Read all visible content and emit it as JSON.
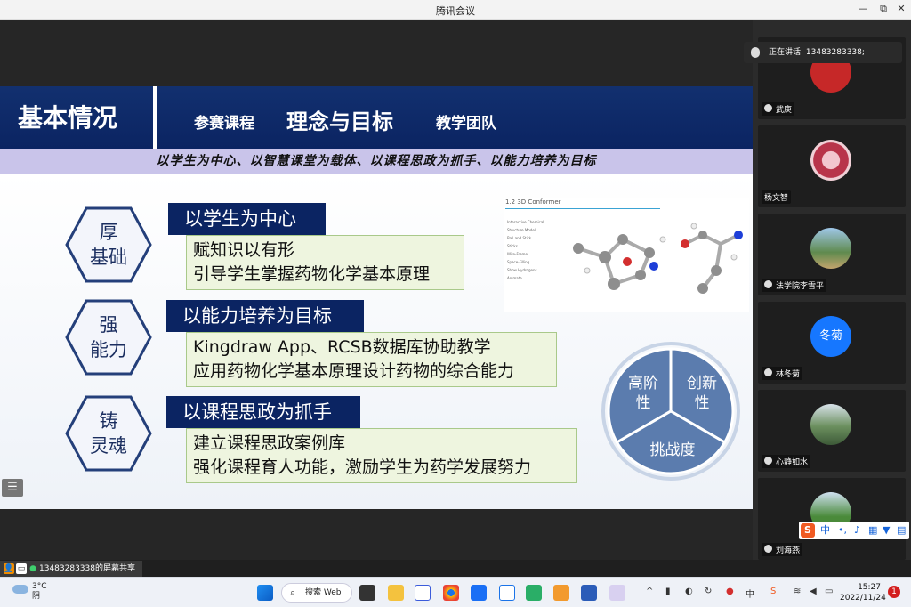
{
  "window": {
    "title": "腾讯会议",
    "min": "—",
    "restore": "⧉",
    "close": "✕"
  },
  "slide": {
    "header_title": "基本情况",
    "tabs": [
      "参赛课程",
      "理念与目标",
      "教学团队"
    ],
    "motto": "以学生为中心、以智慧课堂为载体、以课程思政为抓手、以能力培养为目标",
    "hexes": [
      "厚\n基础",
      "强\n能力",
      "铸\n灵魂"
    ],
    "goals": [
      {
        "title": "以学生为中心",
        "lines": [
          "赋知识以有形",
          "引导学生掌握药物化学基本原理"
        ]
      },
      {
        "title": "以能力培养为目标",
        "lines": [
          "Kingdraw App、RCSB数据库协助教学",
          "应用药物化学基本原理设计药物的综合能力"
        ]
      },
      {
        "title": "以课程思政为抓手",
        "lines": [
          "建立课程思政案例库",
          "强化课程育人功能，激励学生为药学发展努力"
        ]
      }
    ],
    "conformer_caption": "1.2  3D Conformer",
    "conformer_panel": [
      "Interactive Chemical Structure Model",
      "Ball and Stick",
      "Sticks",
      "Wire-Frame",
      "Space-Filling",
      "Show Hydrogens",
      "Animate"
    ],
    "cycle": [
      "高阶\n性",
      "创新\n性",
      "挑战度"
    ]
  },
  "meeting": {
    "speaking": "正在讲话: 13483283338;",
    "screen_share": "13483283338的屏幕共享",
    "participants": [
      {
        "name": "武庚",
        "avatar_color": "#c62828"
      },
      {
        "name": "杨文智",
        "avatar_color": "#b8344a"
      },
      {
        "name": "法学院李雪平",
        "avatar_color": "#5f8a4e"
      },
      {
        "name": "林冬菊",
        "avatar_text": "冬菊",
        "avatar_color": "#1677ff"
      },
      {
        "name": "心静如水",
        "avatar_color": "#6b8f5e"
      },
      {
        "name": "刘海燕",
        "avatar_color": "#4a8a3a"
      }
    ],
    "ime_label": "中"
  },
  "taskbar": {
    "weather_temp": "3°C",
    "weather_desc": "阴",
    "search_label": "搜索 Web",
    "time": "15:27",
    "date": "2022/11/24",
    "notifications": "1",
    "tray_ime": "中"
  }
}
